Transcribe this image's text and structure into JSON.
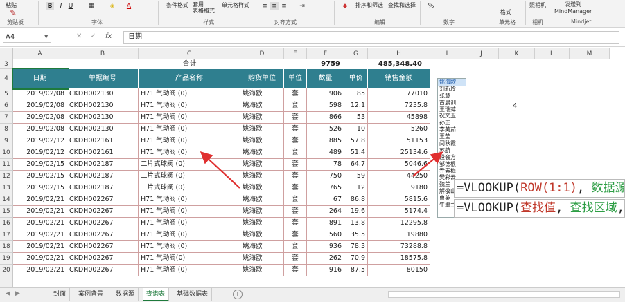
{
  "ribbon": {
    "paste": "粘贴",
    "clipboard_group": "剪贴板",
    "font_group": "字体",
    "style_group": "样式",
    "align_group": "对齐方式",
    "edit_group": "编辑",
    "number_group": "数字",
    "cells_group": "单元格",
    "camera_group": "相机",
    "mindjet_group": "Mindjet",
    "cond_format": "条件格式",
    "table_format": "套用\n表格格式",
    "cell_style": "单元格样式",
    "sort_filter": "排序和筛选",
    "find_select": "查找和选择",
    "format_btn": "格式",
    "camera": "照相机",
    "send_mind": "发送到\nMindManager"
  },
  "formula_bar": {
    "name_box": "A4",
    "fx": "fx",
    "content": "日期"
  },
  "columns": [
    "A",
    "B",
    "C",
    "D",
    "E",
    "F",
    "G",
    "H",
    "I",
    "J",
    "K",
    "L",
    "M"
  ],
  "summary": {
    "label": "合计",
    "qty": "9759",
    "amount": "485,348.40"
  },
  "headers": [
    "日期",
    "单据编号",
    "产品名称",
    "购货单位",
    "单位",
    "数量",
    "单价",
    "销售金额"
  ],
  "rows": [
    [
      "2019/02/08",
      "CKDH002130",
      "H71 气动阀 (0)",
      "姚海欧",
      "套",
      "906",
      "85",
      "77010"
    ],
    [
      "2019/02/08",
      "CKDH002130",
      "H71 气动阀 (0)",
      "姚海欧",
      "套",
      "598",
      "12.1",
      "7235.8"
    ],
    [
      "2019/02/08",
      "CKDH002130",
      "H71 气动阀 (0)",
      "姚海欧",
      "套",
      "866",
      "53",
      "45898"
    ],
    [
      "2019/02/08",
      "CKDH002130",
      "H71 气动阀 (0)",
      "姚海欧",
      "套",
      "526",
      "10",
      "5260"
    ],
    [
      "2019/02/12",
      "CKDH002161",
      "H71 气动阀 (0)",
      "姚海欧",
      "套",
      "885",
      "57.8",
      "51153"
    ],
    [
      "2019/02/12",
      "CKDH002161",
      "H71 气动阀 (0)",
      "姚海欧",
      "套",
      "489",
      "51.4",
      "25134.6"
    ],
    [
      "2019/02/15",
      "CKDH002187",
      "二片式球阀 (0)",
      "姚海欧",
      "套",
      "78",
      "64.7",
      "5046.6"
    ],
    [
      "2019/02/15",
      "CKDH002187",
      "二片式球阀 (0)",
      "姚海欧",
      "套",
      "750",
      "59",
      "44250"
    ],
    [
      "2019/02/15",
      "CKDH002187",
      "二片式球阀 (0)",
      "姚海欧",
      "套",
      "765",
      "12",
      "9180"
    ],
    [
      "2019/02/21",
      "CKDH002267",
      "H71 气动阀 (0)",
      "姚海欧",
      "套",
      "67",
      "86.8",
      "5815.6"
    ],
    [
      "2019/02/21",
      "CKDH002267",
      "H71 气动阀 (0)",
      "姚海欧",
      "套",
      "264",
      "19.6",
      "5174.4"
    ],
    [
      "2019/02/21",
      "CKDH002267",
      "H71 气动阀 (0)",
      "姚海欧",
      "套",
      "891",
      "13.8",
      "12295.8"
    ],
    [
      "2019/02/21",
      "CKDH002267",
      "H71 气动阀 (0)",
      "姚海欧",
      "套",
      "560",
      "35.5",
      "19880"
    ],
    [
      "2019/02/21",
      "CKDH002267",
      "H71 气动阀 (0)",
      "姚海欧",
      "套",
      "936",
      "78.3",
      "73288.8"
    ],
    [
      "2019/02/21",
      "CKDH002267",
      "H71 气动阀(0)",
      "姚海欧",
      "套",
      "262",
      "70.9",
      "18575.8"
    ],
    [
      "2019/02/21",
      "CKDH002267",
      "H71 气动阀 (0)",
      "姚海欧",
      "套",
      "916",
      "87.5",
      "80150"
    ]
  ],
  "k4_value": "4",
  "listbox": [
    "姚海欧",
    "刘新玲",
    "张慧",
    "古晨训",
    "王瑞萍",
    "祝文玉",
    "孙正",
    "李美茹",
    "王莹",
    "闫秋霞",
    "苏航",
    "段会方",
    "邹德根",
    "乔素梅",
    "樊彩云",
    "魏兰",
    "解敬山",
    "曹英",
    "牛翠兰"
  ],
  "tooltip1": {
    "p1": "=VLOOKUP(",
    "p2": "ROW(1:1)",
    "p3": ", ",
    "p4": "数据源!",
    "p5": ""
  },
  "tooltip2": {
    "p1": "=VLOOKUP(",
    "p2": "查找值",
    "p3": ", ",
    "p4": "查找区域",
    "p5": ", "
  },
  "sheet_tabs": [
    "封面",
    "案例背景",
    "数据源",
    "查询表",
    "基础数据表"
  ],
  "active_tab": "查询表",
  "colors": {
    "header_fill": "#2f7f8f",
    "grid_red": "#cfa0a0",
    "arrow": "#e03030",
    "tip_red": "#c0392b",
    "tip_green": "#2e9e45"
  }
}
